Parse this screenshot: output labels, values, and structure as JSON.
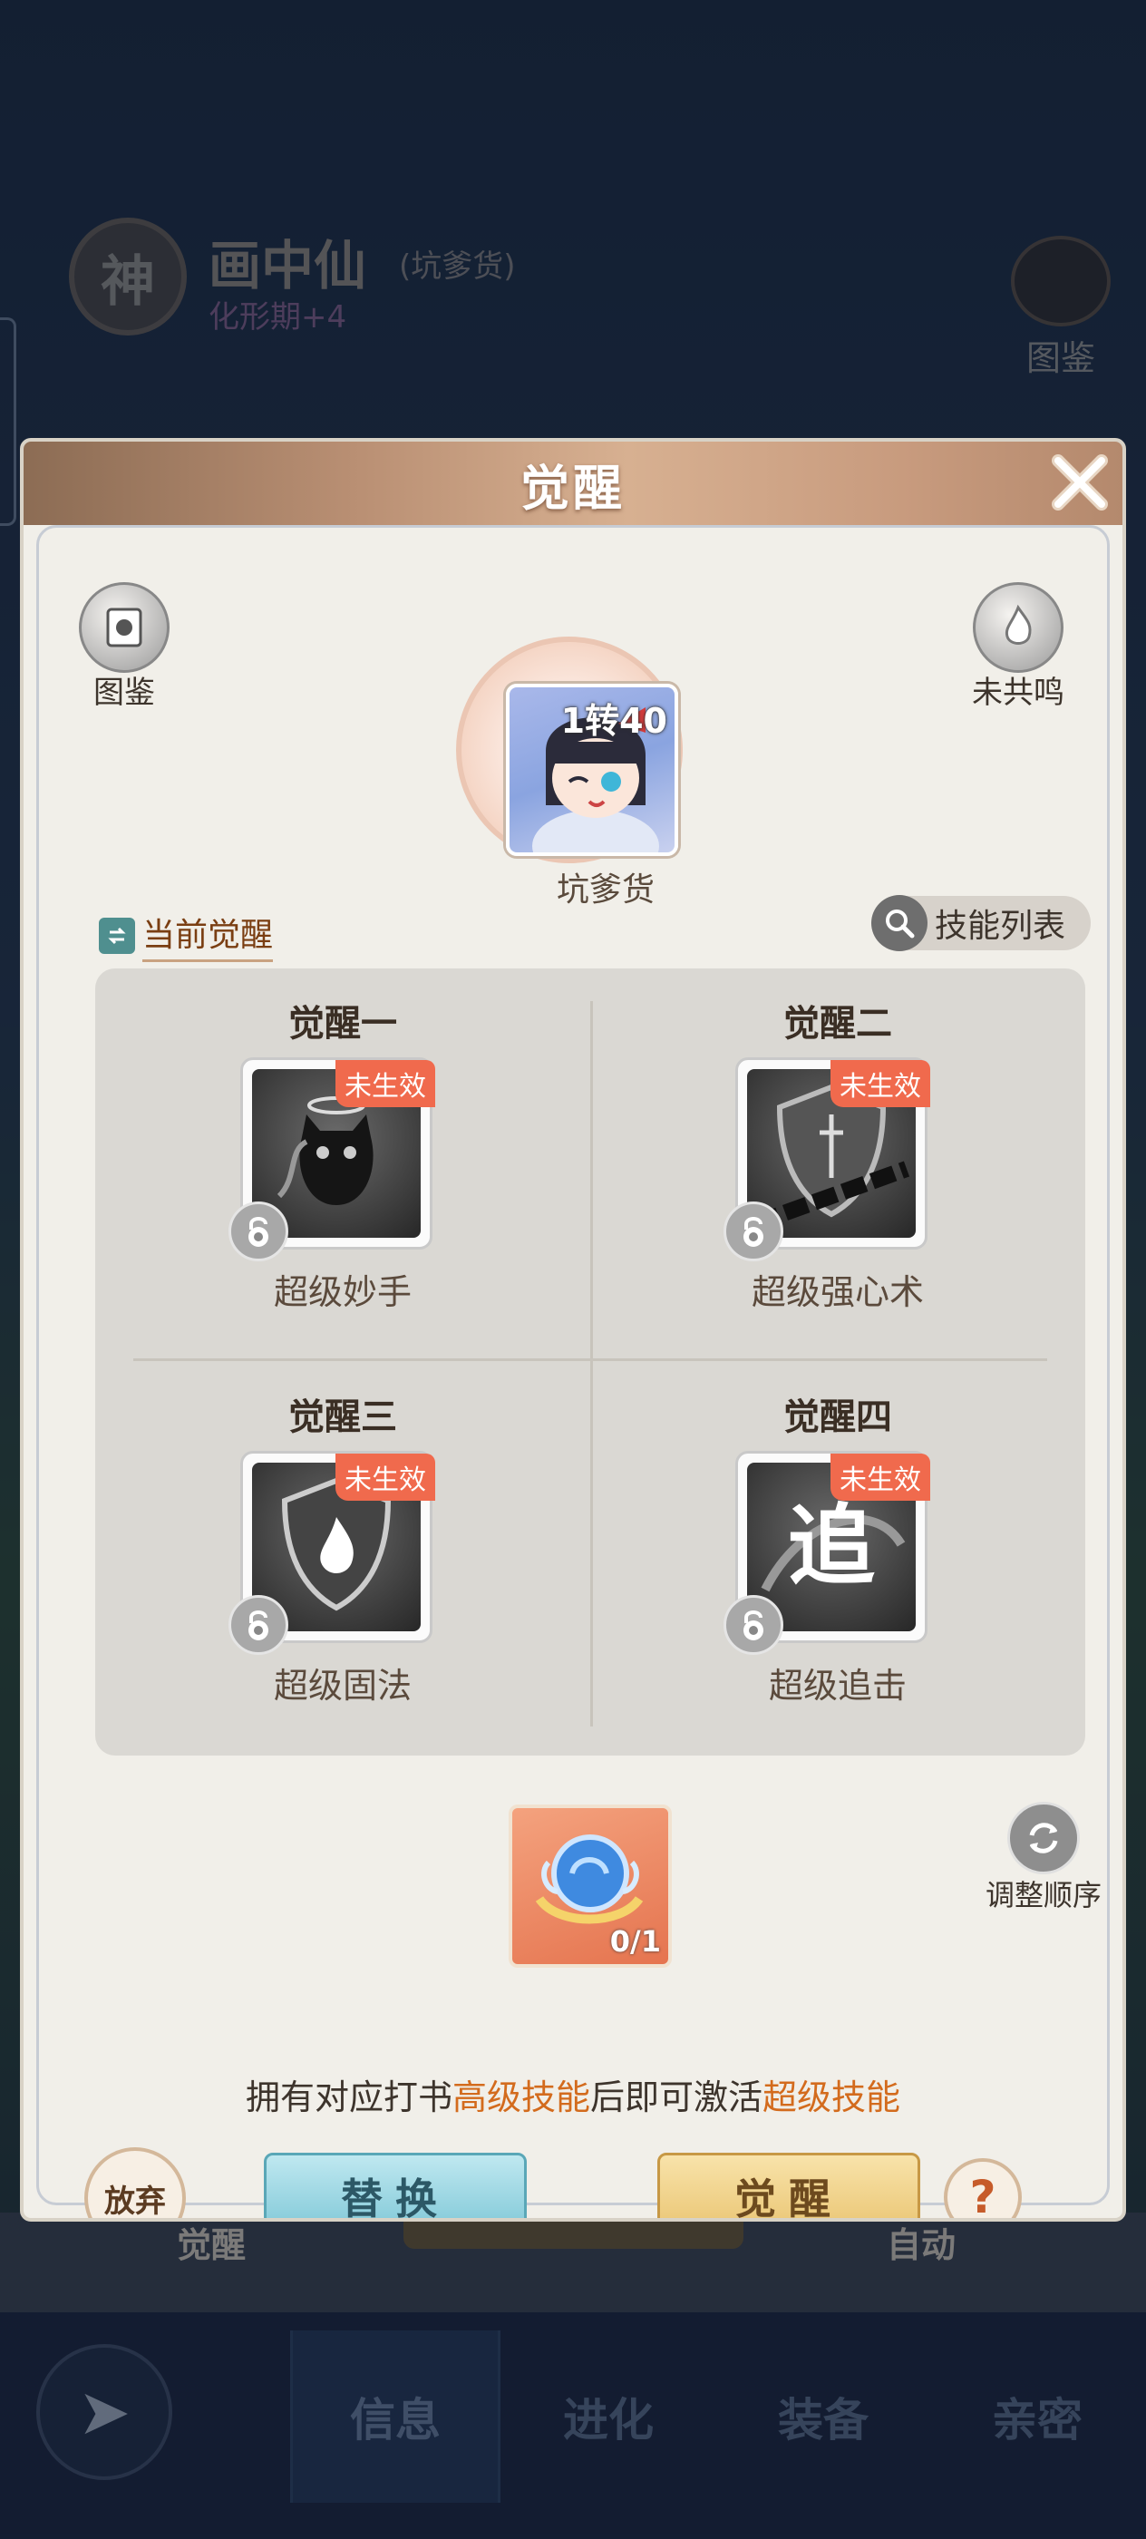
{
  "background": {
    "badge_char": "神",
    "hero_name": "画中仙",
    "hero_subname": "(坑爹货)",
    "hero_stage": "化形期+4",
    "codex_label": "图鉴",
    "behind_left_label": "觉醒",
    "behind_right_label": "自动"
  },
  "nav": {
    "tabs": [
      {
        "label": "信息"
      },
      {
        "label": "进化"
      },
      {
        "label": "装备"
      },
      {
        "label": "亲密"
      }
    ]
  },
  "modal": {
    "title": "觉醒",
    "codex_label": "图鉴",
    "resonance_label": "未共鸣",
    "portrait": {
      "level": "1转40",
      "name": "坑爹货"
    },
    "current_awaken_label": "当前觉醒",
    "skill_list_label": "技能列表",
    "skills": [
      {
        "title": "觉醒一",
        "name": "超级妙手",
        "status": "未生效"
      },
      {
        "title": "觉醒二",
        "name": "超级强心术",
        "status": "未生效"
      },
      {
        "title": "觉醒三",
        "name": "超级固法",
        "status": "未生效"
      },
      {
        "title": "觉醒四",
        "name": "超级追击",
        "status": "未生效"
      }
    ],
    "skill4_glyph": "追",
    "item_count": "0/1",
    "reorder_label": "调整顺序",
    "hint": {
      "part1": "拥有对应打书",
      "highlight1": "高级技能",
      "part2": "后即可激活",
      "highlight2": "超级技能"
    },
    "abandon_label": "放弃",
    "replace_label": "替换",
    "awaken_label": "觉醒",
    "help_label": "?"
  },
  "colors": {
    "highlight": "#d36b1d",
    "status_tag": "#f06a4d"
  }
}
